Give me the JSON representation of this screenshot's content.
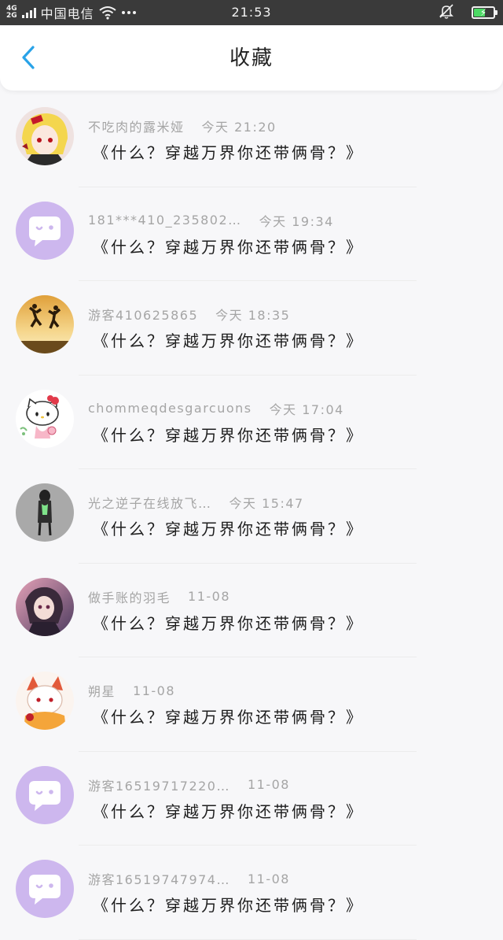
{
  "status_bar": {
    "net_top": "4G",
    "net_bottom": "2G",
    "carrier": "中国电信",
    "time": "21:53",
    "battery_percent": 60,
    "icons": [
      "signal-icon",
      "wifi-icon",
      "more-icon",
      "mute-bell-icon",
      "battery-icon"
    ]
  },
  "header": {
    "back_icon": "chevron-left-icon",
    "title": "收藏"
  },
  "colors": {
    "accent": "#29a3e8",
    "avatar_default": "#cdb7ee",
    "username": "#a5a5a5",
    "title": "#1e1e1e"
  },
  "items": [
    {
      "username": "不吃肉的露米娅",
      "time": "今天 21:20",
      "title": "《什么？穿越万界你还带俩骨？》",
      "avatar": "anime-girl-avatar"
    },
    {
      "username": "181***410_235802…",
      "time": "今天 19:34",
      "title": "《什么？穿越万界你还带俩骨？》",
      "avatar": "default-chat-avatar"
    },
    {
      "username": "游客410625865",
      "time": "今天 18:35",
      "title": "《什么？穿越万界你还带俩骨？》",
      "avatar": "jumping-people-sunset-avatar"
    },
    {
      "username": "chommeqdesgarcuons",
      "time": "今天 17:04",
      "title": "《什么？穿越万界你还带俩骨？》",
      "avatar": "hello-kitty-avatar"
    },
    {
      "username": "光之逆子在线放飞…",
      "time": "今天 15:47",
      "title": "《什么？穿越万界你还带俩骨？》",
      "avatar": "hooded-figure-avatar"
    },
    {
      "username": "做手账的羽毛",
      "time": "11-08",
      "title": "《什么？穿越万界你还带俩骨？》",
      "avatar": "anime-dark-avatar"
    },
    {
      "username": "朔星",
      "time": "11-08",
      "title": "《什么？穿越万界你还带俩骨？》",
      "avatar": "fox-girl-avatar"
    },
    {
      "username": "游客16519717220…",
      "time": "11-08",
      "title": "《什么？穿越万界你还带俩骨？》",
      "avatar": "default-chat-avatar"
    },
    {
      "username": "游客16519747974…",
      "time": "11-08",
      "title": "《什么？穿越万界你还带俩骨？》",
      "avatar": "default-chat-avatar"
    }
  ]
}
